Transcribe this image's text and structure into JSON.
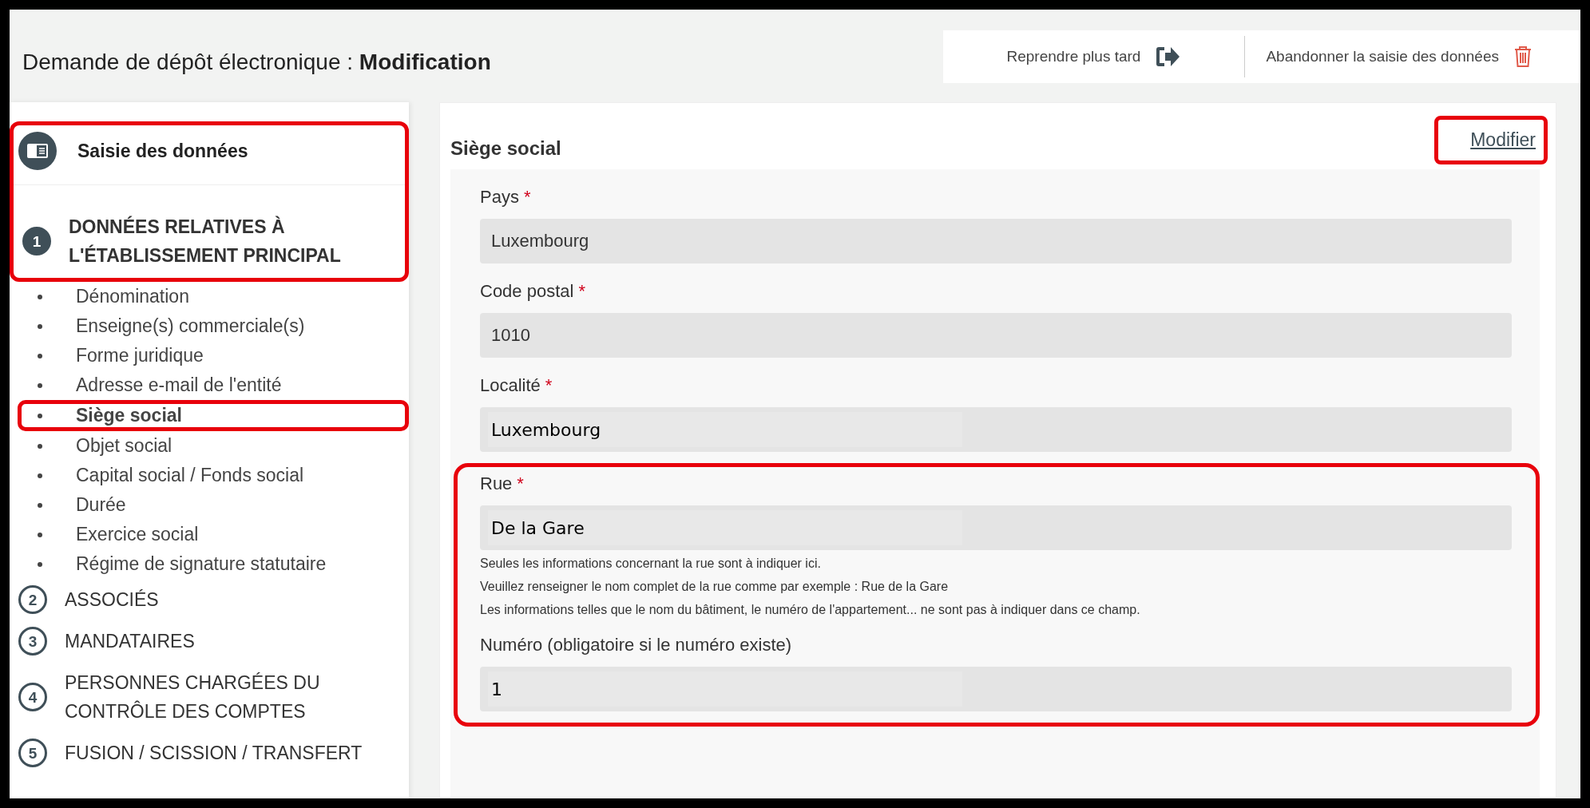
{
  "header": {
    "title": "Demande de dépôt électronique : ",
    "title_bold": "Modification",
    "actions": [
      {
        "label": "Reprendre plus tard",
        "kind": "later"
      },
      {
        "label": "Abandonner la saisie des données",
        "kind": "abandon"
      }
    ]
  },
  "sidebar": {
    "highlighted": true,
    "heading": "Saisie des données",
    "steps": [
      {
        "number": "1",
        "title": "DONNÉES RELATIVES À L'ÉTABLISSEMENT PRINCIPAL",
        "selected": true,
        "children": [
          {
            "label": "Dénomination",
            "selected": false
          },
          {
            "label": "Enseigne(s) commerciale(s)",
            "selected": false
          },
          {
            "label": "Forme juridique",
            "selected": false
          },
          {
            "label": "Adresse e-mail de l'entité",
            "selected": false
          },
          {
            "label": "Siège social",
            "selected": true
          },
          {
            "label": "Objet social",
            "selected": false
          },
          {
            "label": "Capital social / Fonds social",
            "selected": false
          },
          {
            "label": "Durée",
            "selected": false
          },
          {
            "label": "Exercice social",
            "selected": false
          },
          {
            "label": "Régime de signature statutaire",
            "selected": false
          }
        ]
      },
      {
        "number": "2",
        "title": "ASSOCIÉS",
        "selected": false
      },
      {
        "number": "3",
        "title": "MANDATAIRES",
        "selected": false
      },
      {
        "number": "4",
        "title": "PERSONNES CHARGÉES DU CONTRÔLE DES COMPTES",
        "selected": false
      },
      {
        "number": "5",
        "title": "FUSION / SCISSION / TRANSFERT",
        "selected": false
      }
    ]
  },
  "section": {
    "title": "Siège social",
    "required_marker": "*",
    "edit_link": {
      "label": "Modifier",
      "highlighted": true
    },
    "fields": [
      {
        "label": "Pays",
        "required": true,
        "value": "Luxembourg",
        "edited": false,
        "highlighted": false
      },
      {
        "label": "Code postal",
        "required": true,
        "value": "1010",
        "edited": false,
        "highlighted": false
      },
      {
        "label": "Localité",
        "required": true,
        "value": "Luxembourg",
        "edited": true,
        "highlighted": false
      },
      {
        "label": "Rue",
        "required": true,
        "value": "De la Gare",
        "edited": true,
        "highlighted": true,
        "help": [
          "Seules les informations concernant la rue sont à indiquer ici.",
          "Veuillez renseigner le nom complet de la rue comme par exemple : Rue de la Gare",
          "Les informations telles que le nom du bâtiment, le numéro de l'appartement... ne sont pas à indiquer dans ce champ."
        ]
      },
      {
        "label": "Numéro (obligatoire si le numéro existe)",
        "required": false,
        "value": "1",
        "edited": true,
        "highlighted": true
      }
    ]
  }
}
